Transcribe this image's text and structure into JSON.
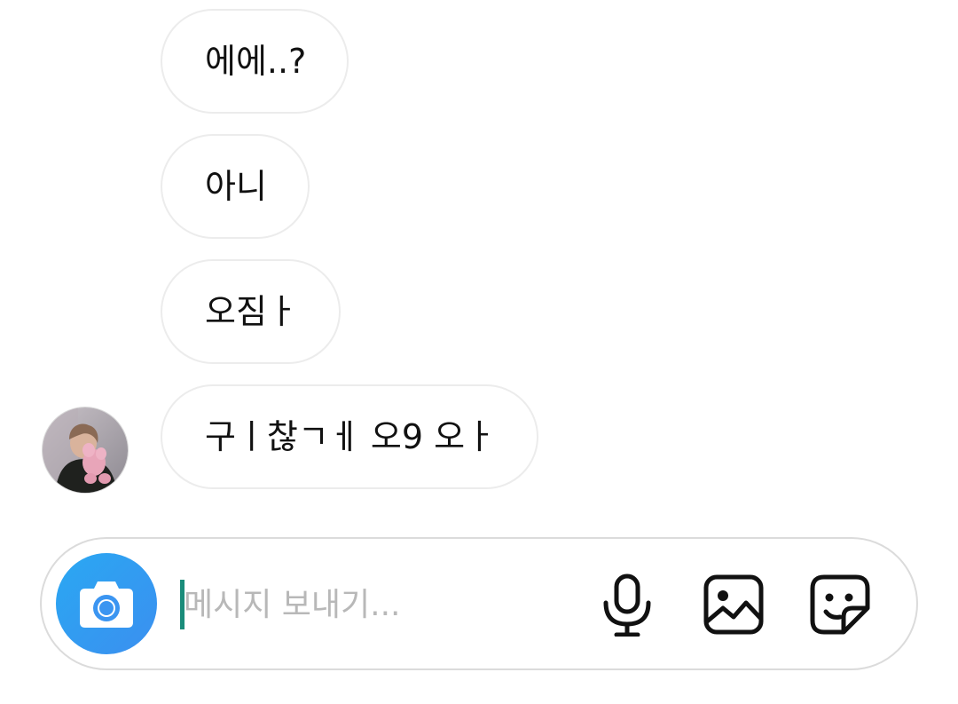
{
  "conversation": {
    "messages": [
      {
        "text": "에에..?"
      },
      {
        "text": "아니"
      },
      {
        "text": "오짐ㅏ"
      },
      {
        "text": "구ㅣ찮ㄱㅔ 오9 오ㅏ"
      }
    ]
  },
  "composer": {
    "placeholder": "메시지 보내기...",
    "value": "",
    "icons": {
      "camera": "camera-icon",
      "mic": "microphone-icon",
      "gallery": "image-icon",
      "sticker": "sticker-icon"
    },
    "accent_color": "#3897f0",
    "caret_color": "#1a8c7a"
  }
}
